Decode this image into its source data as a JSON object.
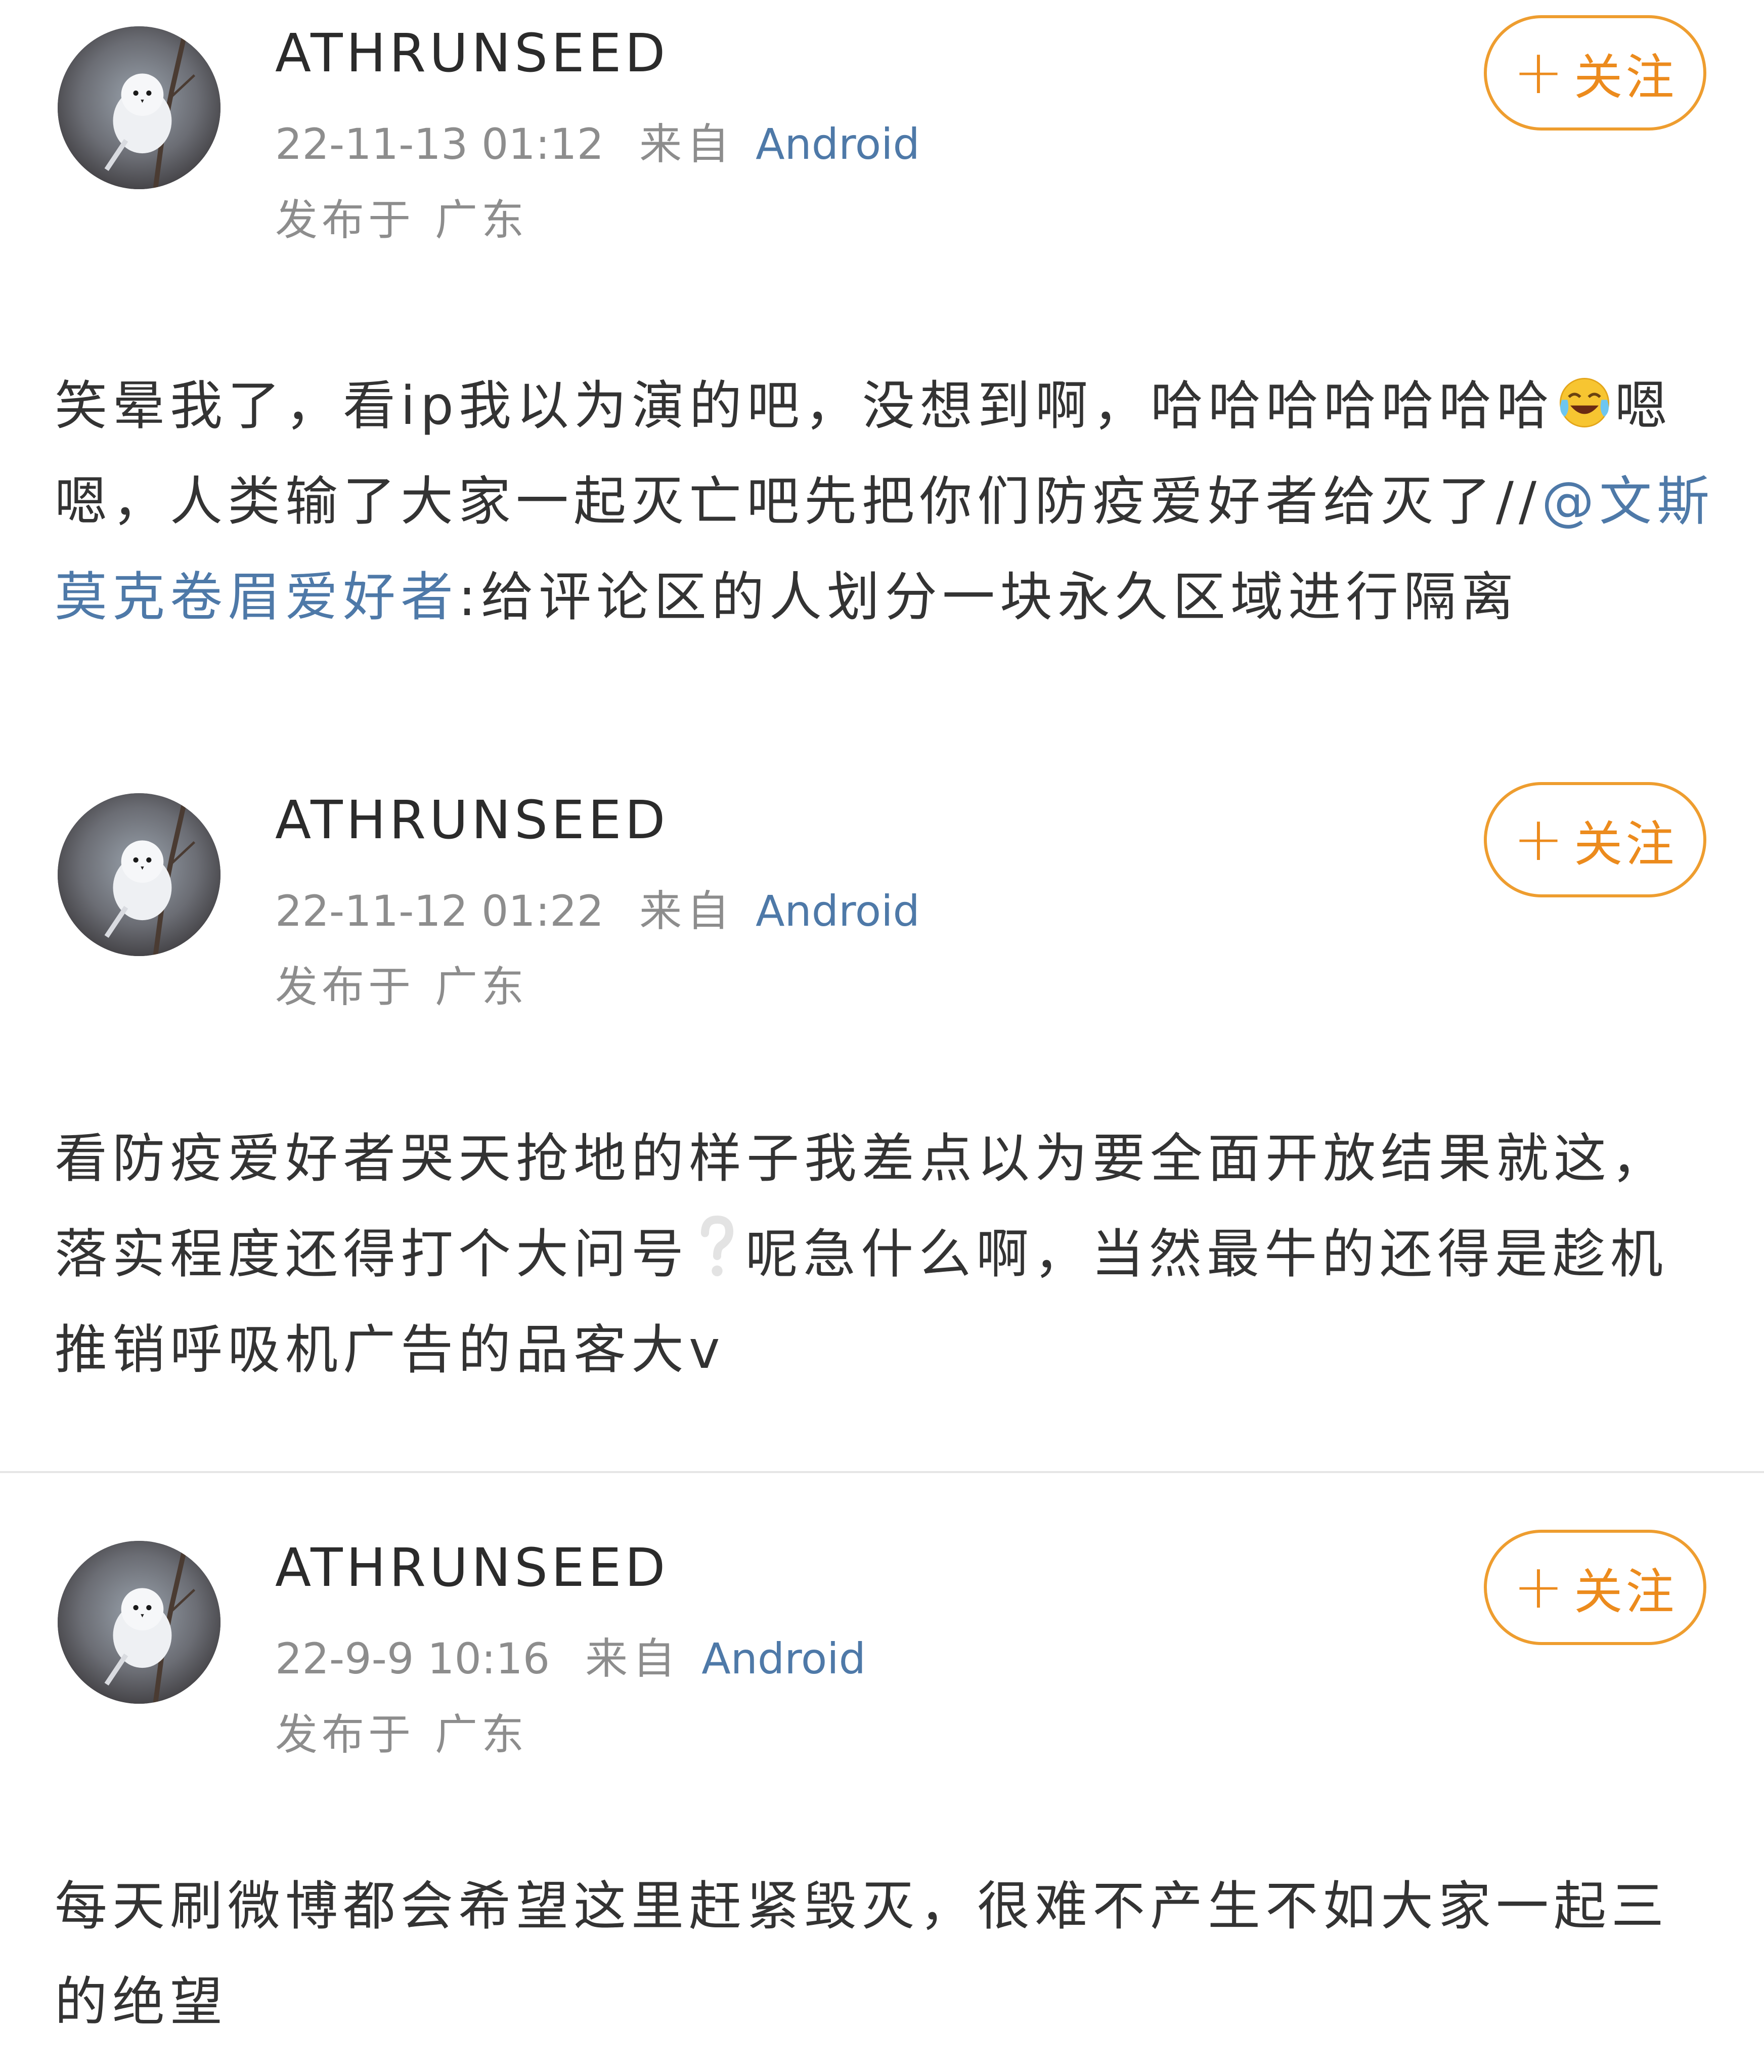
{
  "posts": [
    {
      "username": "ATHRUNSEED",
      "time": "22-11-13 01:12",
      "from_label": "来自",
      "source": "Android",
      "location_label": "发布于",
      "location": "广东",
      "follow_label": "关注",
      "content": {
        "text_1": "笑晕我了，看ip我以为演的吧，没想到啊，哈哈哈哈哈哈哈",
        "emoji_1": "cry-laugh-emoji",
        "text_2": "嗯嗯，人类输了大家一起灭亡吧先把你们防疫爱好者给灭了//",
        "mention": "@文斯莫克卷眉爱好者",
        "text_3": ":给评论区的人划分一块永久区域进行隔离"
      }
    },
    {
      "username": "ATHRUNSEED",
      "time": "22-11-12 01:22",
      "from_label": "来自",
      "source": "Android",
      "location_label": "发布于",
      "location": "广东",
      "follow_label": "关注",
      "content": {
        "text_1": "看防疫爱好者哭天抢地的样子我差点以为要全面开放结果就这，落实程度还得打个大问号",
        "emoji_1": "question-mark-emoji",
        "text_2": "呢急什么啊，当然最牛的还得是趁机推销呼吸机广告的品客大v"
      }
    },
    {
      "username": "ATHRUNSEED",
      "time": "22-9-9 10:16",
      "from_label": "来自",
      "source": "Android",
      "location_label": "发布于",
      "location": "广东",
      "follow_label": "关注",
      "content": {
        "text_1": "每天刷微博都会希望这里赶紧毁灭，很难不产生不如大家一起三的绝望"
      }
    }
  ],
  "colors": {
    "link_blue": "#4e79a8",
    "follow_orange": "#ec8b1d",
    "meta_gray": "#8d8d8d",
    "text_dark": "#333333"
  }
}
